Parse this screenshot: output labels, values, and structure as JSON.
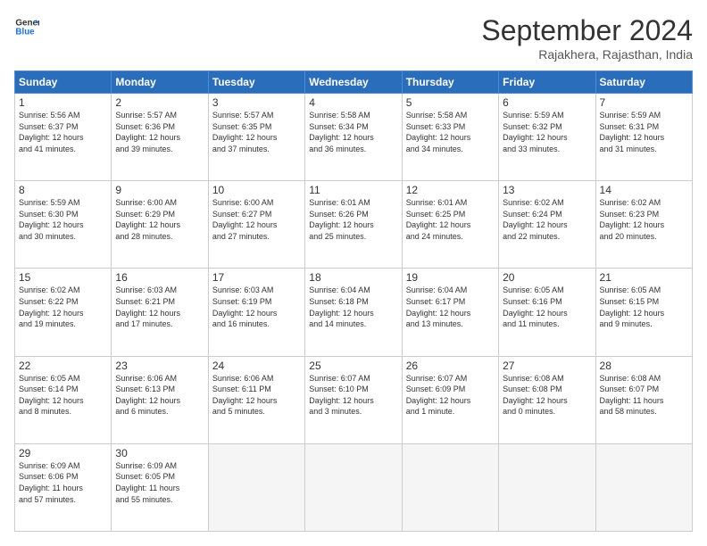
{
  "logo": {
    "line1": "General",
    "line2": "Blue"
  },
  "header": {
    "month": "September 2024",
    "location": "Rajakhera, Rajasthan, India"
  },
  "weekdays": [
    "Sunday",
    "Monday",
    "Tuesday",
    "Wednesday",
    "Thursday",
    "Friday",
    "Saturday"
  ],
  "days": [
    {
      "date": 1,
      "sunrise": "5:56 AM",
      "sunset": "6:37 PM",
      "daylight": "12 hours and 41 minutes."
    },
    {
      "date": 2,
      "sunrise": "5:57 AM",
      "sunset": "6:36 PM",
      "daylight": "12 hours and 39 minutes."
    },
    {
      "date": 3,
      "sunrise": "5:57 AM",
      "sunset": "6:35 PM",
      "daylight": "12 hours and 37 minutes."
    },
    {
      "date": 4,
      "sunrise": "5:58 AM",
      "sunset": "6:34 PM",
      "daylight": "12 hours and 36 minutes."
    },
    {
      "date": 5,
      "sunrise": "5:58 AM",
      "sunset": "6:33 PM",
      "daylight": "12 hours and 34 minutes."
    },
    {
      "date": 6,
      "sunrise": "5:59 AM",
      "sunset": "6:32 PM",
      "daylight": "12 hours and 33 minutes."
    },
    {
      "date": 7,
      "sunrise": "5:59 AM",
      "sunset": "6:31 PM",
      "daylight": "12 hours and 31 minutes."
    },
    {
      "date": 8,
      "sunrise": "5:59 AM",
      "sunset": "6:30 PM",
      "daylight": "12 hours and 30 minutes."
    },
    {
      "date": 9,
      "sunrise": "6:00 AM",
      "sunset": "6:29 PM",
      "daylight": "12 hours and 28 minutes."
    },
    {
      "date": 10,
      "sunrise": "6:00 AM",
      "sunset": "6:27 PM",
      "daylight": "12 hours and 27 minutes."
    },
    {
      "date": 11,
      "sunrise": "6:01 AM",
      "sunset": "6:26 PM",
      "daylight": "12 hours and 25 minutes."
    },
    {
      "date": 12,
      "sunrise": "6:01 AM",
      "sunset": "6:25 PM",
      "daylight": "12 hours and 24 minutes."
    },
    {
      "date": 13,
      "sunrise": "6:02 AM",
      "sunset": "6:24 PM",
      "daylight": "12 hours and 22 minutes."
    },
    {
      "date": 14,
      "sunrise": "6:02 AM",
      "sunset": "6:23 PM",
      "daylight": "12 hours and 20 minutes."
    },
    {
      "date": 15,
      "sunrise": "6:02 AM",
      "sunset": "6:22 PM",
      "daylight": "12 hours and 19 minutes."
    },
    {
      "date": 16,
      "sunrise": "6:03 AM",
      "sunset": "6:21 PM",
      "daylight": "12 hours and 17 minutes."
    },
    {
      "date": 17,
      "sunrise": "6:03 AM",
      "sunset": "6:19 PM",
      "daylight": "12 hours and 16 minutes."
    },
    {
      "date": 18,
      "sunrise": "6:04 AM",
      "sunset": "6:18 PM",
      "daylight": "12 hours and 14 minutes."
    },
    {
      "date": 19,
      "sunrise": "6:04 AM",
      "sunset": "6:17 PM",
      "daylight": "12 hours and 13 minutes."
    },
    {
      "date": 20,
      "sunrise": "6:05 AM",
      "sunset": "6:16 PM",
      "daylight": "12 hours and 11 minutes."
    },
    {
      "date": 21,
      "sunrise": "6:05 AM",
      "sunset": "6:15 PM",
      "daylight": "12 hours and 9 minutes."
    },
    {
      "date": 22,
      "sunrise": "6:05 AM",
      "sunset": "6:14 PM",
      "daylight": "12 hours and 8 minutes."
    },
    {
      "date": 23,
      "sunrise": "6:06 AM",
      "sunset": "6:13 PM",
      "daylight": "12 hours and 6 minutes."
    },
    {
      "date": 24,
      "sunrise": "6:06 AM",
      "sunset": "6:11 PM",
      "daylight": "12 hours and 5 minutes."
    },
    {
      "date": 25,
      "sunrise": "6:07 AM",
      "sunset": "6:10 PM",
      "daylight": "12 hours and 3 minutes."
    },
    {
      "date": 26,
      "sunrise": "6:07 AM",
      "sunset": "6:09 PM",
      "daylight": "12 hours and 1 minute."
    },
    {
      "date": 27,
      "sunrise": "6:08 AM",
      "sunset": "6:08 PM",
      "daylight": "12 hours and 0 minutes."
    },
    {
      "date": 28,
      "sunrise": "6:08 AM",
      "sunset": "6:07 PM",
      "daylight": "11 hours and 58 minutes."
    },
    {
      "date": 29,
      "sunrise": "6:09 AM",
      "sunset": "6:06 PM",
      "daylight": "11 hours and 57 minutes."
    },
    {
      "date": 30,
      "sunrise": "6:09 AM",
      "sunset": "6:05 PM",
      "daylight": "11 hours and 55 minutes."
    }
  ]
}
